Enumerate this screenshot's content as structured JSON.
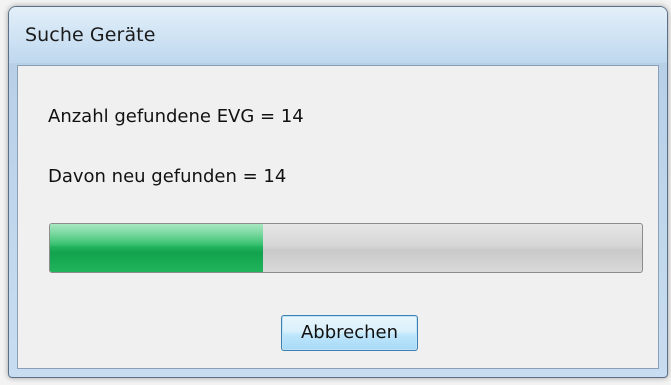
{
  "window": {
    "title": "Suche Geräte"
  },
  "status": {
    "found_total_label": "Anzahl gefundene EVG = 14",
    "found_new_label": "Davon neu gefunden = 14"
  },
  "progress": {
    "fraction": 0.36,
    "fill_color": "#1fb05a",
    "track_color": "#d4d4d4"
  },
  "actions": {
    "cancel_label": "Abbrechen"
  }
}
